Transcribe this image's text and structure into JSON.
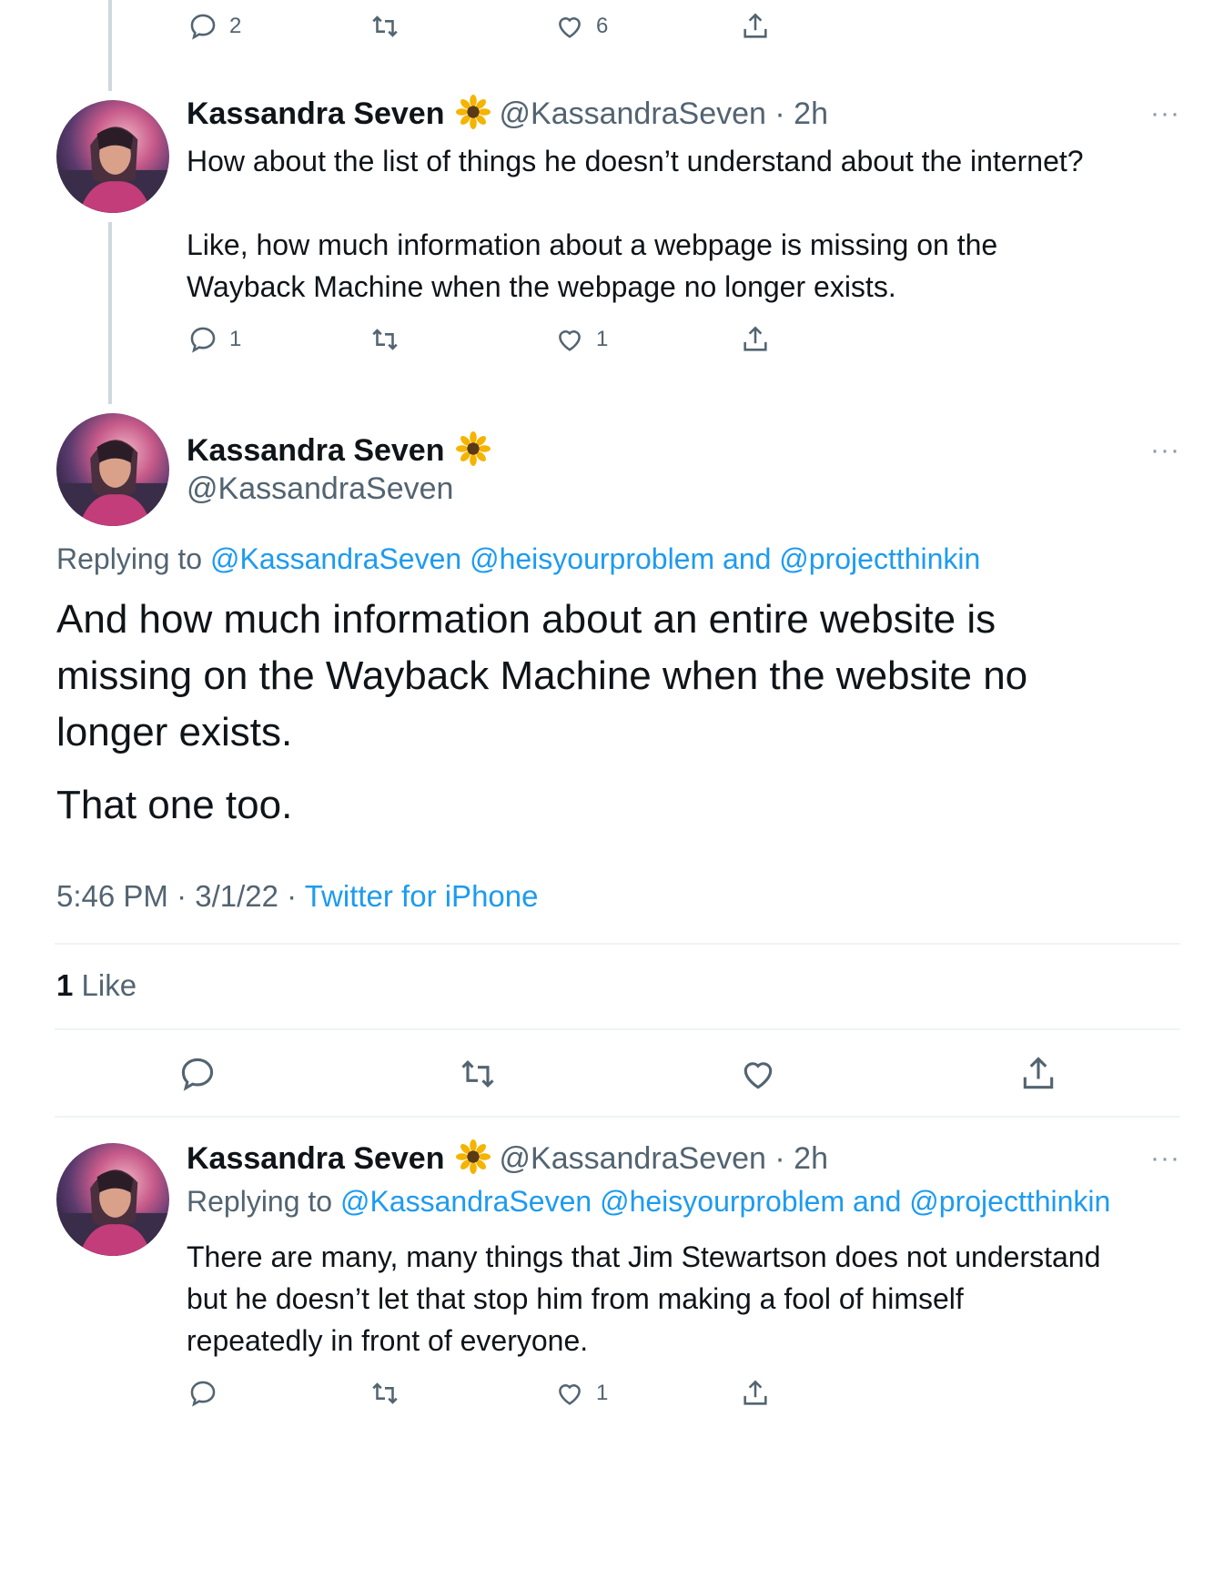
{
  "top_actions": {
    "reply_count": "2",
    "like_count": "6"
  },
  "tweet1": {
    "name": "Kassandra Seven",
    "handle_time": "@KassandraSeven · 2h",
    "more": "···",
    "para1": "How about the list of things he doesn’t understand about the internet?",
    "para2_line1": "Like, how much information about a webpage is missing on the",
    "para2_line2": "Wayback Machine when the webpage no longer exists.",
    "reply_count": "1",
    "like_count": "1"
  },
  "main": {
    "name": "Kassandra Seven",
    "handle": "@KassandraSeven",
    "more": "···",
    "replying_prefix": "Replying to ",
    "replying_users": "@KassandraSeven @heisyourproblem and @projectthinkin",
    "text_line1": "And how much information about an entire website is",
    "text_line2": "missing on the Wayback Machine when the website no",
    "text_line3": "longer exists.",
    "text_line4": "That one too.",
    "timestamp": "5:46 PM · 3/1/22 · ",
    "source": "Twitter for iPhone",
    "likes_count": "1",
    "likes_label": " Like"
  },
  "tweet3": {
    "name": "Kassandra Seven",
    "handle_time": "@KassandraSeven · 2h",
    "more": "···",
    "replying_prefix": "Replying to ",
    "replying_users": "@KassandraSeven @heisyourproblem and @projectthinkin",
    "line1": "There are many, many things that Jim Stewartson does not understand",
    "line2": "but he doesn’t let that stop him from making a fool of himself",
    "line3": "repeatedly in front of everyone.",
    "like_count": "1"
  },
  "colors": {
    "link": "#1d9bf0",
    "secondary": "#536471",
    "thread_line": "#cfd9de"
  }
}
